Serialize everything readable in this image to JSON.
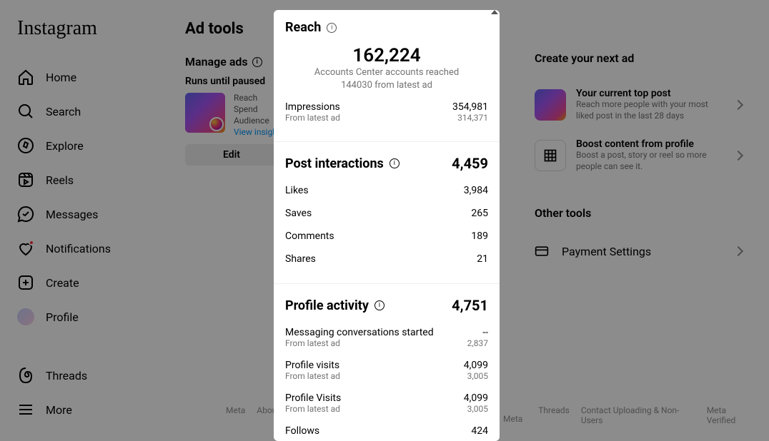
{
  "brand": "Instagram",
  "nav": {
    "home": "Home",
    "search": "Search",
    "explore": "Explore",
    "reels": "Reels",
    "messages": "Messages",
    "notifications": "Notifications",
    "create": "Create",
    "profile": "Profile",
    "threads": "Threads",
    "more": "More"
  },
  "page": {
    "title": "Ad tools",
    "manage": "Manage ads",
    "runs": "Runs until paused",
    "meta": {
      "reach": "Reach",
      "spend": "Spend",
      "audience": "Audience",
      "view": "View insights"
    },
    "edit": "Edit"
  },
  "right": {
    "create": "Create your next ad",
    "card1": {
      "title": "Your current top post",
      "sub": "Reach more people with your most liked post in the last 28 days"
    },
    "card2": {
      "title": "Boost content from profile",
      "sub": "Boost a post, story or reel so more people can see it."
    },
    "other": "Other tools",
    "payment": "Payment Settings"
  },
  "footer": {
    "meta": "Meta",
    "about": "About",
    "threads": "Threads",
    "contact": "Contact Uploading & Non-Users",
    "verified": "Meta Verified",
    "brand": "Meta"
  },
  "modal": {
    "reach": {
      "title": "Reach",
      "hero_num": "162,224",
      "hero_l1": "Accounts Center accounts reached",
      "hero_l2": "144030 from latest ad",
      "imp": "Impressions",
      "imp_v": "354,981",
      "from": "From latest ad",
      "imp_s": "314,371"
    },
    "post": {
      "title": "Post interactions",
      "total": "4,459",
      "likes": "Likes",
      "likes_v": "3,984",
      "saves": "Saves",
      "saves_v": "265",
      "comments": "Comments",
      "comments_v": "189",
      "shares": "Shares",
      "shares_v": "21"
    },
    "profile": {
      "title": "Profile activity",
      "total": "4,751",
      "msg": "Messaging conversations started",
      "msg_v": "--",
      "msg_s": "2,837",
      "pv": "Profile visits",
      "pv_v": "4,099",
      "pv_s": "3,005",
      "pv2": "Profile Visits",
      "pv2_v": "4,099",
      "pv2_s": "3,005",
      "follows": "Follows",
      "follows_v": "424"
    }
  }
}
